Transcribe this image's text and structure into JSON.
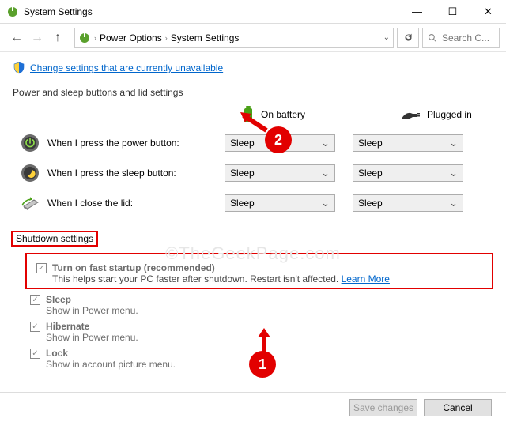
{
  "title": "System Settings",
  "path": {
    "seg1": "Power Options",
    "seg2": "System Settings"
  },
  "search_placeholder": "Search C...",
  "change_link": "Change settings that are currently unavailable",
  "section_heading": "Power and sleep buttons and lid settings",
  "col_battery": "On battery",
  "col_plugged": "Plugged in",
  "rows": {
    "power": {
      "label": "When I press the power button:",
      "battery": "Sleep",
      "plugged": "Sleep"
    },
    "sleep": {
      "label": "When I press the sleep button:",
      "battery": "Sleep",
      "plugged": "Sleep"
    },
    "lid": {
      "label": "When I close the lid:",
      "battery": "Sleep",
      "plugged": "Sleep"
    }
  },
  "shutdown_heading": "Shutdown settings",
  "shutdown": {
    "fast": {
      "label": "Turn on fast startup (recommended)",
      "sub": "This helps start your PC faster after shutdown. Restart isn't affected.",
      "learn": "Learn More"
    },
    "sleep": {
      "label": "Sleep",
      "sub": "Show in Power menu."
    },
    "hibernate": {
      "label": "Hibernate",
      "sub": "Show in Power menu."
    },
    "lock": {
      "label": "Lock",
      "sub": "Show in account picture menu."
    }
  },
  "buttons": {
    "save": "Save changes",
    "cancel": "Cancel"
  },
  "callouts": {
    "one": "1",
    "two": "2"
  },
  "watermark": "©TheGeekPage.com"
}
